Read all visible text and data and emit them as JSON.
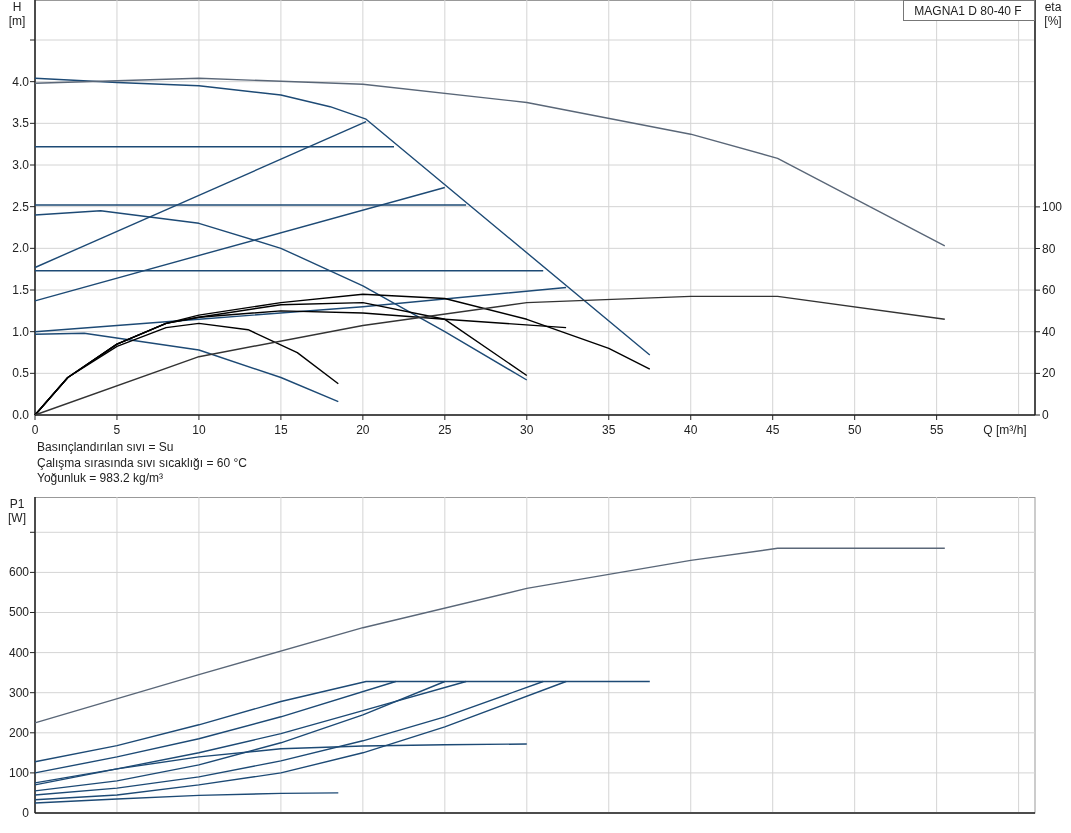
{
  "head_chart": {
    "chart_data": {
      "type": "line",
      "title": "MAGNA1 D 80-40 F",
      "xlabel": "Q [m³/h]",
      "ylabel": "H [m]",
      "y2label": "eta [%]",
      "grid": true,
      "xlim": [
        0,
        61
      ],
      "ylim": [
        0,
        4.98
      ],
      "y2lim": [
        0,
        199.4
      ],
      "xticks": [
        0,
        5,
        10,
        15,
        20,
        25,
        30,
        35,
        40,
        45,
        50,
        55
      ],
      "yticks": [
        {
          "value": 0,
          "label": "0.0"
        },
        {
          "value": 0.5,
          "label": "0.5"
        },
        {
          "value": 1,
          "label": "1.0"
        },
        {
          "value": 1.5,
          "label": "1.5"
        },
        {
          "value": 2,
          "label": "2.0"
        },
        {
          "value": 2.5,
          "label": "2.5"
        },
        {
          "value": 3,
          "label": "3.0"
        },
        {
          "value": 3.5,
          "label": "3.5"
        },
        {
          "value": 4,
          "label": "4.0"
        }
      ],
      "y2ticks": [
        0,
        20,
        40,
        60,
        80,
        100
      ],
      "series": [
        {
          "color": "#1d4a75",
          "x": [
            0,
            5,
            10,
            15,
            18,
            20.2,
            37.5
          ],
          "values": [
            4.04,
            3.99,
            3.95,
            3.84,
            3.7,
            3.55,
            0.72
          ]
        },
        {
          "color": "#1d4a75",
          "x": [
            0,
            21.9
          ],
          "values": [
            3.22,
            3.22
          ]
        },
        {
          "color": "#1d4a75",
          "x": [
            0,
            26.3
          ],
          "values": [
            2.52,
            2.52
          ]
        },
        {
          "color": "#1d4a75",
          "x": [
            0,
            31
          ],
          "values": [
            1.73,
            1.73
          ]
        },
        {
          "color": "#1d4a75",
          "x": [
            0,
            20.2
          ],
          "values": [
            1.77,
            3.52
          ]
        },
        {
          "color": "#1d4a75",
          "x": [
            0,
            25
          ],
          "values": [
            1.37,
            2.73
          ]
        },
        {
          "color": "#1d4a75",
          "x": [
            0,
            10,
            20,
            32.4
          ],
          "values": [
            1.0,
            1.15,
            1.3,
            1.53
          ]
        },
        {
          "color": "#1d4a75",
          "x": [
            0,
            4,
            10,
            15,
            20,
            25,
            30
          ],
          "values": [
            2.4,
            2.45,
            2.3,
            2.0,
            1.55,
            1.0,
            0.42
          ]
        },
        {
          "color": "#1d4a75",
          "x": [
            0,
            3,
            10,
            15,
            18.5
          ],
          "values": [
            0.97,
            0.98,
            0.78,
            0.45,
            0.16
          ]
        },
        {
          "color": "#000000",
          "axis": "y2",
          "x": [
            0,
            2,
            5,
            8,
            10,
            13,
            16,
            18.5
          ],
          "values": [
            0,
            18,
            33,
            42,
            44,
            41,
            30,
            15
          ]
        },
        {
          "color": "#000000",
          "axis": "y2",
          "x": [
            0,
            2,
            5,
            8,
            10,
            15,
            20,
            25,
            30,
            35,
            37.5
          ],
          "values": [
            0,
            18,
            34,
            44,
            48,
            54,
            58,
            56,
            46,
            32,
            22
          ]
        },
        {
          "color": "#000000",
          "axis": "y2",
          "x": [
            0,
            2,
            5,
            8,
            10,
            15,
            20,
            25,
            30
          ],
          "values": [
            0,
            18,
            34,
            44,
            47,
            53,
            54,
            46,
            19
          ]
        },
        {
          "color": "#000000",
          "axis": "y2",
          "x": [
            0,
            2,
            5,
            8,
            10,
            15,
            20,
            25,
            32.4
          ],
          "values": [
            0,
            18,
            34,
            44,
            47,
            50,
            49,
            46,
            42
          ]
        },
        {
          "color": "#5a6778",
          "x": [
            0,
            10,
            20,
            30,
            40,
            45.3,
            55.5
          ],
          "values": [
            3.98,
            4.04,
            3.97,
            3.75,
            3.37,
            3.08,
            2.03
          ]
        },
        {
          "color": "#333333",
          "axis": "y2",
          "x": [
            0,
            10,
            20,
            30,
            40,
            45.3,
            55.5
          ],
          "values": [
            0,
            28,
            43,
            54,
            57,
            57,
            46
          ]
        }
      ]
    }
  },
  "liquid_notes": [
    "Basınçlandırılan sıvı = Su",
    "Çalışma sırasında sıvı sıcaklığı = 60 °C",
    "Yoğunluk = 983.2 kg/m³"
  ],
  "power_chart": {
    "chart_data": {
      "type": "line",
      "ylabel": "P1 [W]",
      "grid": true,
      "xlim": [
        0,
        61
      ],
      "ylim": [
        0,
        788
      ],
      "yticks": [
        0,
        100,
        200,
        300,
        400,
        500,
        600
      ],
      "series": [
        {
          "color": "#5a6778",
          "x": [
            0,
            10,
            20,
            30,
            40,
            45.3,
            55.5
          ],
          "values": [
            225,
            345,
            462,
            560,
            630,
            660,
            660
          ]
        },
        {
          "color": "#1d4a75",
          "x": [
            0,
            5,
            10,
            15,
            20.2,
            37.5
          ],
          "values": [
            128,
            168,
            220,
            278,
            328,
            328
          ]
        },
        {
          "color": "#1d4a75",
          "x": [
            0,
            5,
            10,
            15,
            22
          ],
          "values": [
            100,
            140,
            185,
            240,
            328
          ]
        },
        {
          "color": "#1d4a75",
          "x": [
            0,
            5,
            10,
            15,
            20,
            26.3
          ],
          "values": [
            75,
            110,
            150,
            198,
            255,
            328
          ]
        },
        {
          "color": "#1d4a75",
          "x": [
            0,
            5,
            10,
            15,
            20,
            25
          ],
          "values": [
            55,
            80,
            120,
            175,
            245,
            328
          ]
        },
        {
          "color": "#1d4a75",
          "x": [
            0,
            5,
            10,
            15,
            20,
            25,
            30
          ],
          "values": [
            70,
            110,
            140,
            160,
            167,
            170,
            172
          ]
        },
        {
          "color": "#1d4a75",
          "x": [
            0,
            5,
            10,
            15,
            20,
            25,
            31
          ],
          "values": [
            45,
            62,
            90,
            130,
            180,
            240,
            328
          ]
        },
        {
          "color": "#1d4a75",
          "x": [
            0,
            5,
            10,
            15,
            20,
            25,
            32.4
          ],
          "values": [
            33,
            45,
            70,
            100,
            150,
            215,
            328
          ]
        },
        {
          "color": "#1d4a75",
          "x": [
            0,
            5,
            10,
            15,
            18.5
          ],
          "values": [
            25,
            35,
            44,
            49,
            50
          ]
        }
      ]
    }
  }
}
